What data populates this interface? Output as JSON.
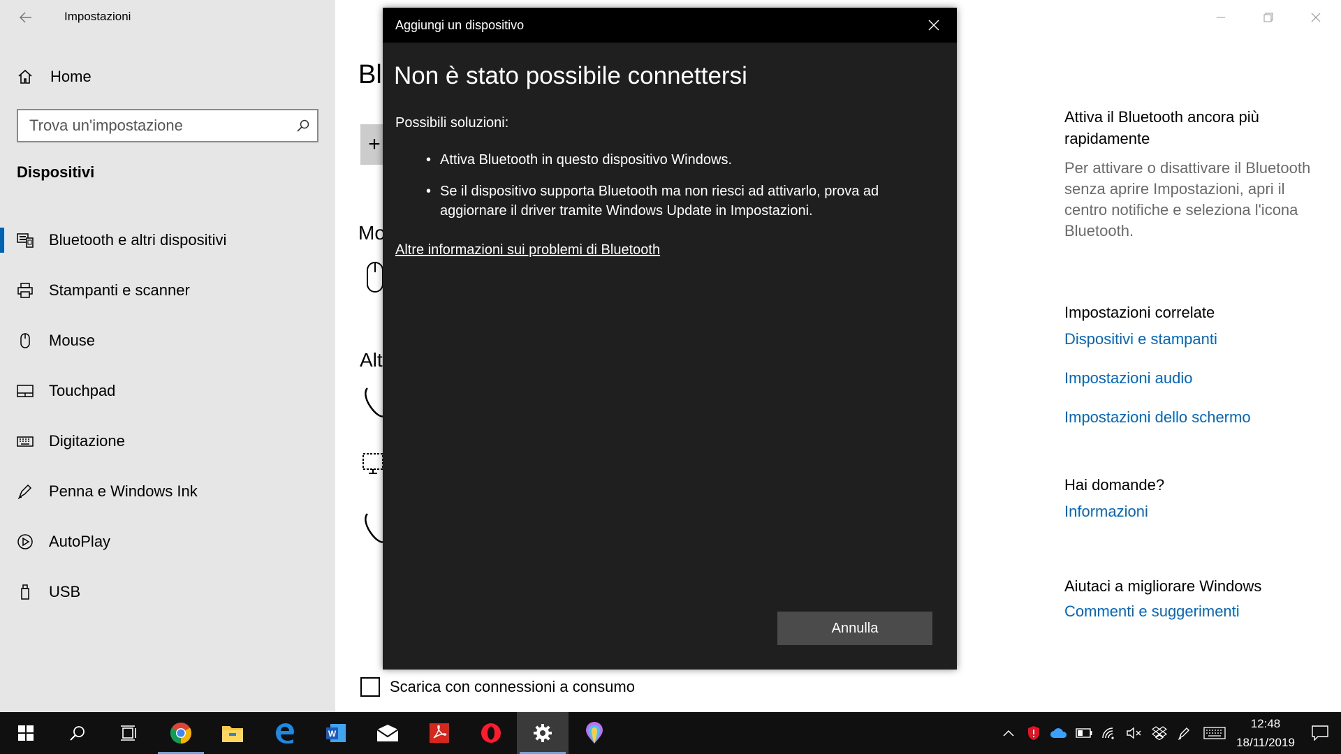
{
  "window": {
    "app_title": "Impostazioni"
  },
  "sidebar": {
    "home_label": "Home",
    "search_placeholder": "Trova un'impostazione",
    "section_title": "Dispositivi",
    "items": [
      {
        "label": "Bluetooth e altri dispositivi",
        "icon": "bluetooth-devices-icon",
        "selected": true
      },
      {
        "label": "Stampanti e scanner",
        "icon": "printer-icon"
      },
      {
        "label": "Mouse",
        "icon": "mouse-icon"
      },
      {
        "label": "Touchpad",
        "icon": "touchpad-icon"
      },
      {
        "label": "Digitazione",
        "icon": "keyboard-icon"
      },
      {
        "label": "Penna e Windows Ink",
        "icon": "pen-icon"
      },
      {
        "label": "AutoPlay",
        "icon": "autoplay-icon"
      },
      {
        "label": "USB",
        "icon": "usb-icon"
      }
    ]
  },
  "main": {
    "heading_peek": "Bl",
    "section_peek_1": "Mo",
    "section_peek_2": "Alt",
    "metered_label": "Scarica con connessioni a consumo"
  },
  "right_panel": {
    "tip_title": "Attiva il Bluetooth ancora più rapidamente",
    "tip_desc": "Per attivare o disattivare il Bluetooth senza aprire Impostazioni, apri il centro notifiche e seleziona l'icona Bluetooth.",
    "related_title": "Impostazioni correlate",
    "related_links": [
      "Dispositivi e stampanti",
      "Impostazioni audio",
      "Impostazioni dello schermo"
    ],
    "questions_title": "Hai domande?",
    "questions_link": "Informazioni",
    "improve_title": "Aiutaci a migliorare Windows",
    "improve_link": "Commenti e suggerimenti"
  },
  "dialog": {
    "title": "Aggiungi un dispositivo",
    "heading": "Non è stato possibile connettersi",
    "solutions_label": "Possibili soluzioni:",
    "solutions": [
      "Attiva Bluetooth in questo dispositivo Windows.",
      "Se il dispositivo supporta Bluetooth ma non riesci ad attivarlo, prova ad aggiornare il driver tramite Windows Update in Impostazioni."
    ],
    "more_info_link": "Altre informazioni sui problemi di Bluetooth",
    "cancel_label": "Annulla"
  },
  "taskbar": {
    "apps": [
      "start",
      "search",
      "task-view",
      "chrome",
      "file-explorer",
      "edge",
      "word",
      "mail",
      "acrobat",
      "opera",
      "settings",
      "paint-3d"
    ],
    "time": "12:48",
    "date": "18/11/2019"
  },
  "colors": {
    "accent": "#0063b1",
    "link": "#0067c0",
    "dialog_bg": "#1f1f1f",
    "taskbar_bg": "#101010"
  }
}
